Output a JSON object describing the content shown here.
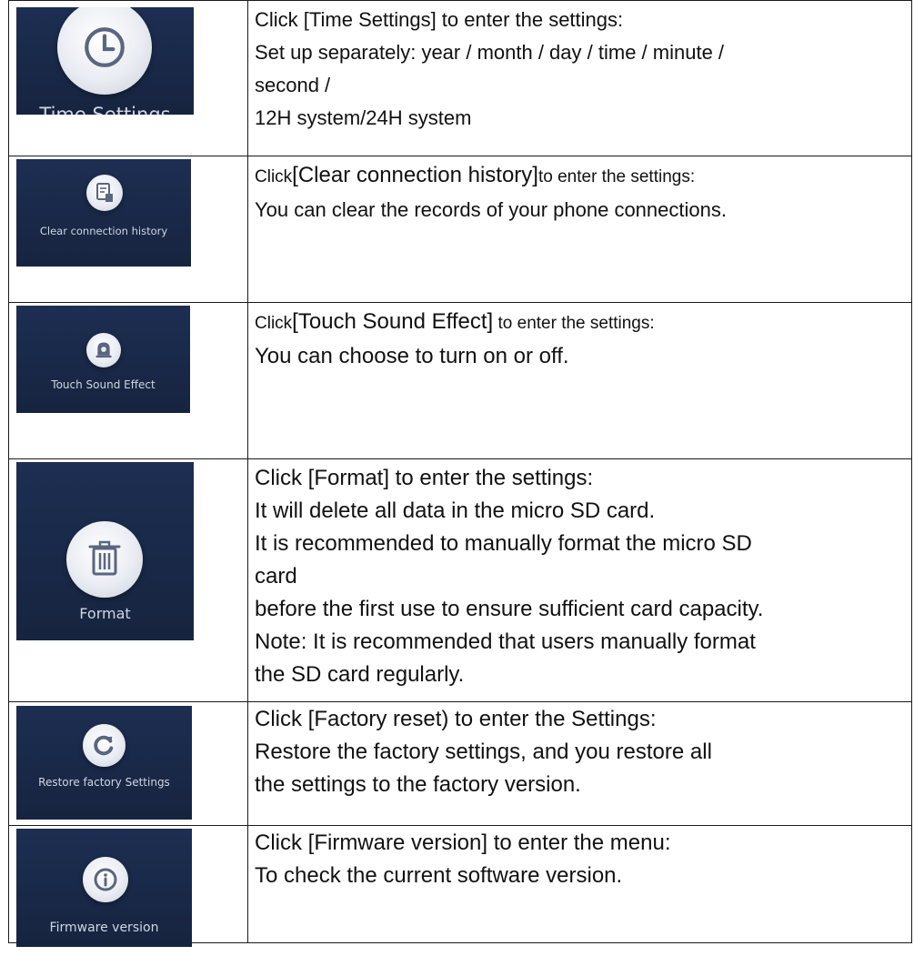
{
  "rows": [
    {
      "thumb": {
        "caption": "Time Settings",
        "icon": "clock-icon"
      },
      "lines": [
        "Click [Time Settings] to enter the settings:",
        "Set up separately: year / month / day / time / minute /",
        "second /",
        "12H system/24H system"
      ]
    },
    {
      "thumb": {
        "caption": "Clear connection history",
        "icon": "document-delete-icon"
      },
      "line1": {
        "pre": "Click",
        "mid": "[Clear connection history]",
        "post": "to enter the settings:"
      },
      "lines": [
        "You can clear the records of your phone connections."
      ]
    },
    {
      "thumb": {
        "caption": "Touch Sound Effect",
        "icon": "bell-icon"
      },
      "line1": {
        "pre": "Click",
        "mid": "[Touch Sound Effect]",
        "post": " to enter the settings:"
      },
      "lines": [
        "You can choose to turn on or off."
      ]
    },
    {
      "thumb": {
        "caption": "Format",
        "icon": "trash-icon"
      },
      "lines": [
        "Click [Format] to enter the settings:",
        "It will delete all data in the micro SD card.",
        "It is recommended to manually format the micro SD",
        "card",
        "before the first use to ensure sufficient card capacity.",
        "Note: It is recommended that users manually format",
        "the SD card regularly."
      ]
    },
    {
      "thumb": {
        "caption": "Restore factory Settings",
        "icon": "refresh-icon"
      },
      "lines": [
        "Click [Factory reset) to enter the Settings:",
        "Restore the factory settings, and you restore all",
        "the settings to the factory version."
      ]
    },
    {
      "thumb": {
        "caption": "Firmware version",
        "icon": "info-icon"
      },
      "lines": [
        "Click [Firmware version] to enter the menu:",
        "To check the current software version."
      ]
    }
  ],
  "colors": {
    "thumb_bg": "#1d2e52",
    "icon_circle": "#e9ecf2",
    "icon_glyph": "#5a6580",
    "caption": "#cfd6e4",
    "border": "#1a1a1a"
  }
}
